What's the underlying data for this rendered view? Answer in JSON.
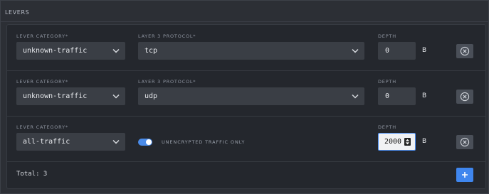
{
  "section": {
    "title": "LEVERS"
  },
  "labels": {
    "category": "LEVER CATEGORY*",
    "protocol": "LAYER 3 PROTOCOL*",
    "depth": "DEPTH"
  },
  "rows": [
    {
      "category": "unknown-traffic",
      "protocol": "tcp",
      "depth": "0",
      "unit": "B"
    },
    {
      "category": "unknown-traffic",
      "protocol": "udp",
      "depth": "0",
      "unit": "B"
    },
    {
      "category": "all-traffic",
      "toggle_label": "UNENCRYPTED TRAFFIC ONLY",
      "toggle_on": true,
      "depth": "2000",
      "unit": "B"
    }
  ],
  "footer": {
    "total": "Total: 3"
  },
  "icons": {
    "chevron": "chevron-down-icon",
    "remove": "circle-x-icon",
    "add": "plus-icon",
    "spinner": "spinner-arrows-icon"
  },
  "colors": {
    "accent": "#3f86ee",
    "background": "#2c2f35",
    "field": "#3a3e45"
  }
}
